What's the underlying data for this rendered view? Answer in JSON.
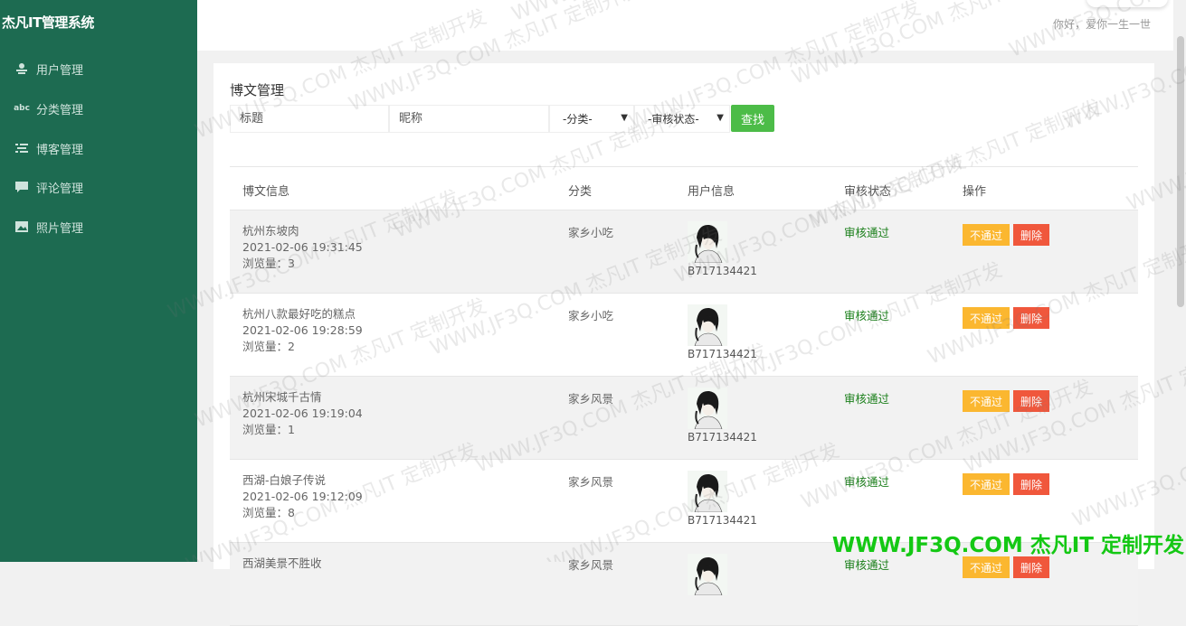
{
  "app": {
    "title": "杰凡IT管理系统"
  },
  "sidebar": {
    "items": [
      {
        "label": "用户管理",
        "icon": "user-icon"
      },
      {
        "label": "分类管理",
        "icon": "abc-icon"
      },
      {
        "label": "博客管理",
        "icon": "list-icon"
      },
      {
        "label": "评论管理",
        "icon": "comment-icon"
      },
      {
        "label": "照片管理",
        "icon": "image-icon"
      }
    ]
  },
  "header": {
    "greeting": "你好，爱你一生一世"
  },
  "panel": {
    "title": "博文管理",
    "filters": {
      "title_placeholder": "标题",
      "nickname_placeholder": "昵称",
      "category_value": "-分类-",
      "status_value": "-审核状态-",
      "search_label": "查找"
    }
  },
  "table": {
    "headers": [
      "博文信息",
      "分类",
      "用户信息",
      "审核状态",
      "操作"
    ],
    "views_prefix": "浏览量：",
    "reject_label": "不通过",
    "delete_label": "删除",
    "rows": [
      {
        "title": "杭州东坡肉",
        "time": "2021-02-06 19:31:45",
        "views": "3",
        "category": "家乡小吃",
        "user": "B717134421",
        "status": "审核通过"
      },
      {
        "title": "杭州八款最好吃的糕点",
        "time": "2021-02-06 19:28:59",
        "views": "2",
        "category": "家乡小吃",
        "user": "B717134421",
        "status": "审核通过"
      },
      {
        "title": "杭州宋城千古情",
        "time": "2021-02-06 19:19:04",
        "views": "1",
        "category": "家乡风景",
        "user": "B717134421",
        "status": "审核通过"
      },
      {
        "title": "西湖-白娘子传说",
        "time": "2021-02-06 19:12:09",
        "views": "8",
        "category": "家乡风景",
        "user": "B717134421",
        "status": "审核通过"
      },
      {
        "title": "西湖美景不胜收",
        "time": "",
        "views": "",
        "category": "家乡风景",
        "user": "",
        "status": "审核通过"
      }
    ]
  },
  "watermark": {
    "text": "WWW.JF3Q.COM 杰凡IT 定制开发",
    "corner": "WWW.JF3Q.COM 杰凡IT  定制开发"
  },
  "colors": {
    "sidebar": "#1d6b51",
    "search": "#4cbc48",
    "reject": "#fbb730",
    "delete": "#f0573c",
    "status_ok": "#1a7f1a"
  }
}
